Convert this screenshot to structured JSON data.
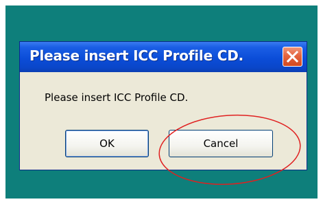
{
  "dialog": {
    "title": "Please insert ICC Profile CD.",
    "message": "Please insert ICC Profile CD.",
    "ok_label": "OK",
    "cancel_label": "Cancel",
    "close_icon": "close-icon"
  },
  "annotation": {
    "shape": "ellipse",
    "color": "#e02020",
    "target": "cancel-button"
  },
  "colors": {
    "desktop": "#0e7f7b",
    "titlebar": "#0b4dd8",
    "dialog_body": "#ece9d8",
    "close_button": "#e4643f"
  }
}
